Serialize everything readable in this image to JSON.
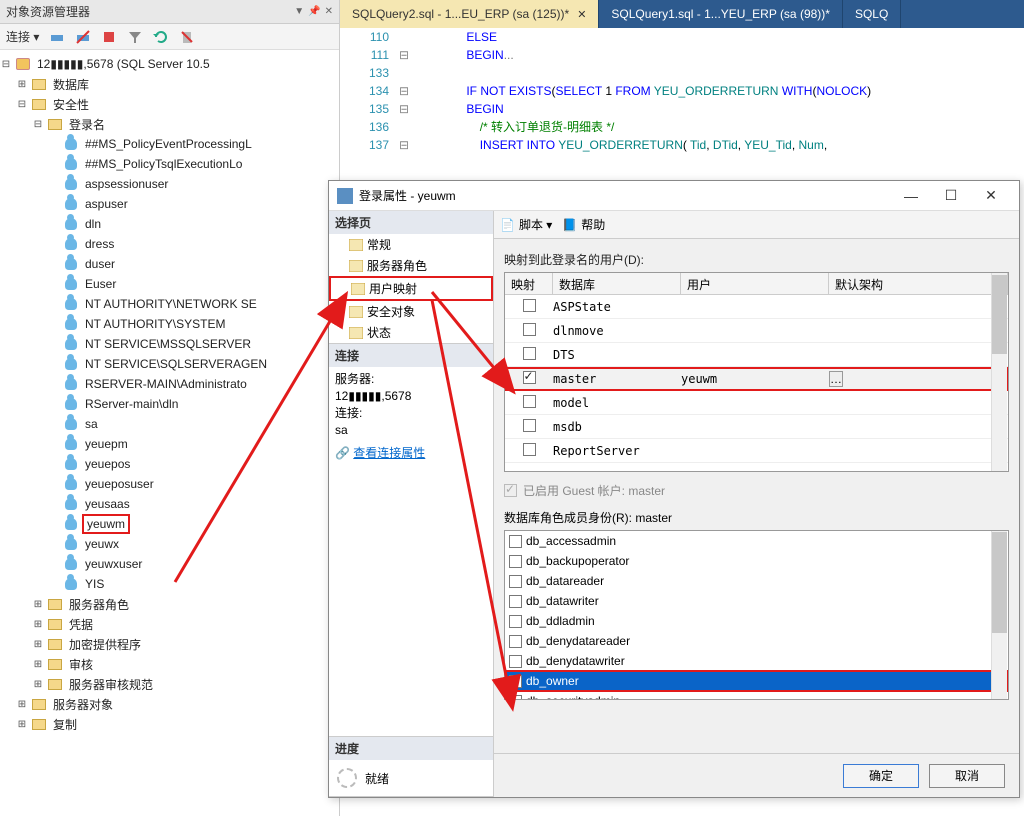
{
  "object_explorer": {
    "title": "对象资源管理器",
    "toolbar_label": "连接 ▾",
    "root": "12▮▮▮▮▮,5678 (SQL Server 10.5",
    "folders": {
      "databases": "数据库",
      "security": "安全性",
      "logins": "登录名",
      "server_roles": "服务器角色",
      "credentials": "凭据",
      "crypto_providers": "加密提供程序",
      "audits": "审核",
      "server_audit_specs": "服务器审核规范",
      "server_objects": "服务器对象",
      "replication": "复制"
    },
    "logins": [
      "##MS_PolicyEventProcessingL",
      "##MS_PolicyTsqlExecutionLo",
      "aspsessionuser",
      "aspuser",
      "dln",
      "dress",
      "duser",
      "Euser",
      "NT AUTHORITY\\NETWORK SE",
      "NT AUTHORITY\\SYSTEM",
      "NT SERVICE\\MSSQLSERVER",
      "NT SERVICE\\SQLSERVERAGEN",
      "RSERVER-MAIN\\Administrato",
      "RServer-main\\dln",
      "sa",
      "yeuepm",
      "yeuepos",
      "yeueposuser",
      "yeusaas",
      "yeuwm",
      "yeuwx",
      "yeuwxuser",
      "YIS"
    ],
    "highlighted_login": "yeuwm"
  },
  "editor": {
    "tabs": [
      {
        "label": "SQLQuery2.sql - 1...EU_ERP (sa (125))*",
        "active": true
      },
      {
        "label": "SQLQuery1.sql - 1...YEU_ERP (sa (98))*",
        "active": false
      },
      {
        "label": "SQLQ",
        "active": false
      }
    ],
    "lines": [
      {
        "n": "110",
        "fold": "",
        "text_plain": "ELSE"
      },
      {
        "n": "111",
        "fold": "⊟",
        "text_plain": "BEGIN..."
      },
      {
        "n": "133",
        "fold": "",
        "text_plain": ""
      },
      {
        "n": "134",
        "fold": "⊟",
        "text_plain": "IF NOT EXISTS(SELECT 1 FROM YEU_ORDERRETURN WITH(NOLOCK)"
      },
      {
        "n": "135",
        "fold": "⊟",
        "text_plain": "BEGIN"
      },
      {
        "n": "136",
        "fold": "",
        "text_plain": "/* 转入订单退货-明细表 */"
      },
      {
        "n": "137",
        "fold": "⊟",
        "text_plain": "INSERT INTO YEU_ORDERRETURN( Tid, DTid, YEU_Tid, Num,"
      }
    ]
  },
  "dialog": {
    "title": "登录属性 - yeuwm",
    "left": {
      "pages_header": "选择页",
      "pages": [
        "常规",
        "服务器角色",
        "用户映射",
        "安全对象",
        "状态"
      ],
      "highlighted_page": "用户映射",
      "conn_header": "连接",
      "server_label": "服务器:",
      "server_value": "12▮▮▮▮▮,5678",
      "conn_label": "连接:",
      "conn_value": "sa",
      "view_conn_props": "查看连接属性",
      "progress_header": "进度",
      "progress_value": "就绪"
    },
    "right": {
      "toolbar": {
        "script": "脚本",
        "help": "帮助"
      },
      "map_label": "映射到此登录名的用户(D):",
      "grid_headers": {
        "map": "映射",
        "db": "数据库",
        "user": "用户",
        "schema": "默认架构"
      },
      "rows": [
        {
          "checked": false,
          "db": "ASPState",
          "user": "",
          "boxed": false
        },
        {
          "checked": false,
          "db": "dlnmove",
          "user": "",
          "boxed": false
        },
        {
          "checked": false,
          "db": "DTS",
          "user": "",
          "boxed": false
        },
        {
          "checked": true,
          "db": "master",
          "user": "yeuwm",
          "boxed": true,
          "dots": true
        },
        {
          "checked": false,
          "db": "model",
          "user": "",
          "boxed": false
        },
        {
          "checked": false,
          "db": "msdb",
          "user": "",
          "boxed": false
        },
        {
          "checked": false,
          "db": "ReportServer",
          "user": "",
          "boxed": false
        }
      ],
      "guest_label": "已启用 Guest 帐户: master",
      "roles_label": "数据库角色成员身份(R): master",
      "roles": [
        {
          "name": "db_accessadmin",
          "checked": false
        },
        {
          "name": "db_backupoperator",
          "checked": false
        },
        {
          "name": "db_datareader",
          "checked": false
        },
        {
          "name": "db_datawriter",
          "checked": false
        },
        {
          "name": "db_ddladmin",
          "checked": false
        },
        {
          "name": "db_denydatareader",
          "checked": false
        },
        {
          "name": "db_denydatawriter",
          "checked": false
        },
        {
          "name": "db_owner",
          "checked": true,
          "selected": true,
          "boxed": true
        },
        {
          "name": "db_securityadmin",
          "checked": false
        }
      ],
      "buttons": {
        "ok": "确定",
        "cancel": "取消"
      }
    }
  }
}
